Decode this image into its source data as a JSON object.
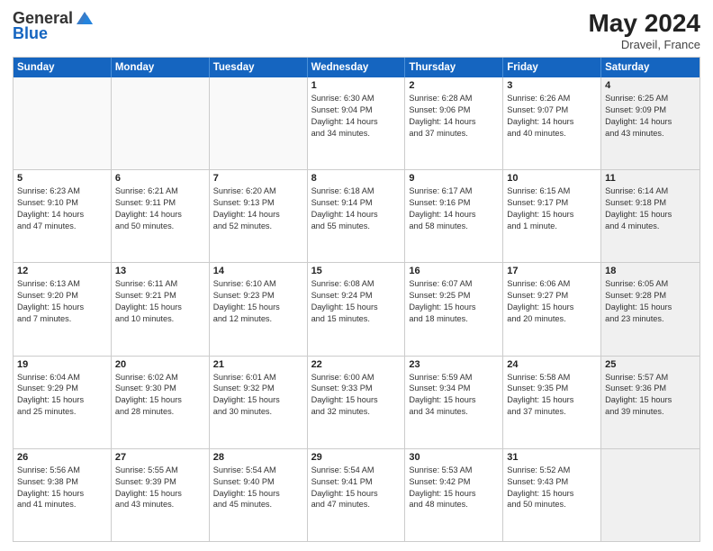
{
  "header": {
    "logo_general": "General",
    "logo_blue": "Blue",
    "month_year": "May 2024",
    "location": "Draveil, France"
  },
  "days_of_week": [
    "Sunday",
    "Monday",
    "Tuesday",
    "Wednesday",
    "Thursday",
    "Friday",
    "Saturday"
  ],
  "weeks": [
    [
      {
        "day": "",
        "lines": [],
        "empty": true
      },
      {
        "day": "",
        "lines": [],
        "empty": true
      },
      {
        "day": "",
        "lines": [],
        "empty": true
      },
      {
        "day": "1",
        "lines": [
          "Sunrise: 6:30 AM",
          "Sunset: 9:04 PM",
          "Daylight: 14 hours",
          "and 34 minutes."
        ],
        "empty": false
      },
      {
        "day": "2",
        "lines": [
          "Sunrise: 6:28 AM",
          "Sunset: 9:06 PM",
          "Daylight: 14 hours",
          "and 37 minutes."
        ],
        "empty": false
      },
      {
        "day": "3",
        "lines": [
          "Sunrise: 6:26 AM",
          "Sunset: 9:07 PM",
          "Daylight: 14 hours",
          "and 40 minutes."
        ],
        "empty": false
      },
      {
        "day": "4",
        "lines": [
          "Sunrise: 6:25 AM",
          "Sunset: 9:09 PM",
          "Daylight: 14 hours",
          "and 43 minutes."
        ],
        "shaded": true,
        "empty": false
      }
    ],
    [
      {
        "day": "5",
        "lines": [
          "Sunrise: 6:23 AM",
          "Sunset: 9:10 PM",
          "Daylight: 14 hours",
          "and 47 minutes."
        ],
        "empty": false
      },
      {
        "day": "6",
        "lines": [
          "Sunrise: 6:21 AM",
          "Sunset: 9:11 PM",
          "Daylight: 14 hours",
          "and 50 minutes."
        ],
        "empty": false
      },
      {
        "day": "7",
        "lines": [
          "Sunrise: 6:20 AM",
          "Sunset: 9:13 PM",
          "Daylight: 14 hours",
          "and 52 minutes."
        ],
        "empty": false
      },
      {
        "day": "8",
        "lines": [
          "Sunrise: 6:18 AM",
          "Sunset: 9:14 PM",
          "Daylight: 14 hours",
          "and 55 minutes."
        ],
        "empty": false
      },
      {
        "day": "9",
        "lines": [
          "Sunrise: 6:17 AM",
          "Sunset: 9:16 PM",
          "Daylight: 14 hours",
          "and 58 minutes."
        ],
        "empty": false
      },
      {
        "day": "10",
        "lines": [
          "Sunrise: 6:15 AM",
          "Sunset: 9:17 PM",
          "Daylight: 15 hours",
          "and 1 minute."
        ],
        "empty": false
      },
      {
        "day": "11",
        "lines": [
          "Sunrise: 6:14 AM",
          "Sunset: 9:18 PM",
          "Daylight: 15 hours",
          "and 4 minutes."
        ],
        "shaded": true,
        "empty": false
      }
    ],
    [
      {
        "day": "12",
        "lines": [
          "Sunrise: 6:13 AM",
          "Sunset: 9:20 PM",
          "Daylight: 15 hours",
          "and 7 minutes."
        ],
        "empty": false
      },
      {
        "day": "13",
        "lines": [
          "Sunrise: 6:11 AM",
          "Sunset: 9:21 PM",
          "Daylight: 15 hours",
          "and 10 minutes."
        ],
        "empty": false
      },
      {
        "day": "14",
        "lines": [
          "Sunrise: 6:10 AM",
          "Sunset: 9:23 PM",
          "Daylight: 15 hours",
          "and 12 minutes."
        ],
        "empty": false
      },
      {
        "day": "15",
        "lines": [
          "Sunrise: 6:08 AM",
          "Sunset: 9:24 PM",
          "Daylight: 15 hours",
          "and 15 minutes."
        ],
        "empty": false
      },
      {
        "day": "16",
        "lines": [
          "Sunrise: 6:07 AM",
          "Sunset: 9:25 PM",
          "Daylight: 15 hours",
          "and 18 minutes."
        ],
        "empty": false
      },
      {
        "day": "17",
        "lines": [
          "Sunrise: 6:06 AM",
          "Sunset: 9:27 PM",
          "Daylight: 15 hours",
          "and 20 minutes."
        ],
        "empty": false
      },
      {
        "day": "18",
        "lines": [
          "Sunrise: 6:05 AM",
          "Sunset: 9:28 PM",
          "Daylight: 15 hours",
          "and 23 minutes."
        ],
        "shaded": true,
        "empty": false
      }
    ],
    [
      {
        "day": "19",
        "lines": [
          "Sunrise: 6:04 AM",
          "Sunset: 9:29 PM",
          "Daylight: 15 hours",
          "and 25 minutes."
        ],
        "empty": false
      },
      {
        "day": "20",
        "lines": [
          "Sunrise: 6:02 AM",
          "Sunset: 9:30 PM",
          "Daylight: 15 hours",
          "and 28 minutes."
        ],
        "empty": false
      },
      {
        "day": "21",
        "lines": [
          "Sunrise: 6:01 AM",
          "Sunset: 9:32 PM",
          "Daylight: 15 hours",
          "and 30 minutes."
        ],
        "empty": false
      },
      {
        "day": "22",
        "lines": [
          "Sunrise: 6:00 AM",
          "Sunset: 9:33 PM",
          "Daylight: 15 hours",
          "and 32 minutes."
        ],
        "empty": false
      },
      {
        "day": "23",
        "lines": [
          "Sunrise: 5:59 AM",
          "Sunset: 9:34 PM",
          "Daylight: 15 hours",
          "and 34 minutes."
        ],
        "empty": false
      },
      {
        "day": "24",
        "lines": [
          "Sunrise: 5:58 AM",
          "Sunset: 9:35 PM",
          "Daylight: 15 hours",
          "and 37 minutes."
        ],
        "empty": false
      },
      {
        "day": "25",
        "lines": [
          "Sunrise: 5:57 AM",
          "Sunset: 9:36 PM",
          "Daylight: 15 hours",
          "and 39 minutes."
        ],
        "shaded": true,
        "empty": false
      }
    ],
    [
      {
        "day": "26",
        "lines": [
          "Sunrise: 5:56 AM",
          "Sunset: 9:38 PM",
          "Daylight: 15 hours",
          "and 41 minutes."
        ],
        "empty": false
      },
      {
        "day": "27",
        "lines": [
          "Sunrise: 5:55 AM",
          "Sunset: 9:39 PM",
          "Daylight: 15 hours",
          "and 43 minutes."
        ],
        "empty": false
      },
      {
        "day": "28",
        "lines": [
          "Sunrise: 5:54 AM",
          "Sunset: 9:40 PM",
          "Daylight: 15 hours",
          "and 45 minutes."
        ],
        "empty": false
      },
      {
        "day": "29",
        "lines": [
          "Sunrise: 5:54 AM",
          "Sunset: 9:41 PM",
          "Daylight: 15 hours",
          "and 47 minutes."
        ],
        "empty": false
      },
      {
        "day": "30",
        "lines": [
          "Sunrise: 5:53 AM",
          "Sunset: 9:42 PM",
          "Daylight: 15 hours",
          "and 48 minutes."
        ],
        "empty": false
      },
      {
        "day": "31",
        "lines": [
          "Sunrise: 5:52 AM",
          "Sunset: 9:43 PM",
          "Daylight: 15 hours",
          "and 50 minutes."
        ],
        "empty": false
      },
      {
        "day": "",
        "lines": [],
        "empty": true,
        "shaded": true
      }
    ]
  ]
}
